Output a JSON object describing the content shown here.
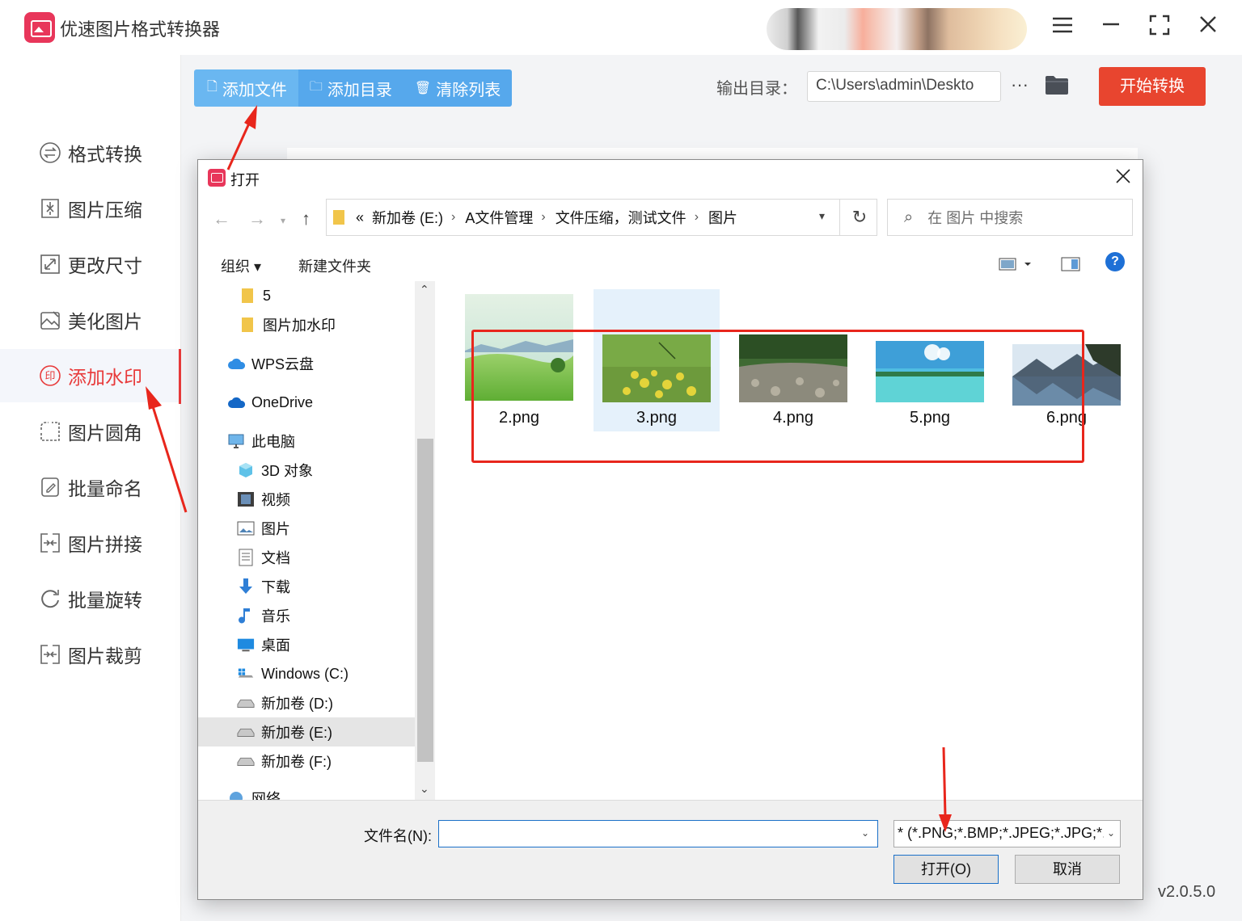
{
  "app": {
    "title": "优速图片格式转换器",
    "version": "v2.0.5.0"
  },
  "window_controls": [
    "menu-icon",
    "minimize-icon",
    "maximize-icon",
    "close-icon"
  ],
  "sidebar": {
    "items": [
      {
        "label": "格式转换",
        "icon": "format-convert-icon"
      },
      {
        "label": "图片压缩",
        "icon": "compress-icon"
      },
      {
        "label": "更改尺寸",
        "icon": "resize-icon"
      },
      {
        "label": "美化图片",
        "icon": "beautify-icon"
      },
      {
        "label": "添加水印",
        "icon": "watermark-icon",
        "active": true
      },
      {
        "label": "图片圆角",
        "icon": "round-corner-icon"
      },
      {
        "label": "批量命名",
        "icon": "rename-icon"
      },
      {
        "label": "图片拼接",
        "icon": "stitch-icon"
      },
      {
        "label": "批量旋转",
        "icon": "rotate-icon"
      },
      {
        "label": "图片裁剪",
        "icon": "crop-icon"
      }
    ]
  },
  "toolbar": {
    "add_file": "添加文件",
    "add_dir": "添加目录",
    "clear_list": "清除列表"
  },
  "output": {
    "label": "输出目录：",
    "path": "C:\\Users\\admin\\Deskto",
    "more": "···"
  },
  "start_button": "开始转换",
  "dialog": {
    "title": "打开",
    "breadcrumb": {
      "overflow": "«",
      "segments": [
        "新加卷 (E:)",
        "A文件管理",
        "文件压缩，测试文件",
        "图片"
      ]
    },
    "search_placeholder": "在 图片 中搜索",
    "commands": {
      "organize": "组织",
      "new_folder": "新建文件夹"
    },
    "tree": [
      {
        "label": "5",
        "icon": "folder-icon"
      },
      {
        "label": "图片加水印",
        "icon": "folder-icon"
      },
      {
        "label": "WPS云盘",
        "icon": "cloud-icon"
      },
      {
        "label": "OneDrive",
        "icon": "onedrive-icon"
      },
      {
        "label": "此电脑",
        "icon": "computer-icon"
      },
      {
        "label": "3D 对象",
        "icon": "3d-objects-icon"
      },
      {
        "label": "视频",
        "icon": "video-icon"
      },
      {
        "label": "图片",
        "icon": "pictures-icon"
      },
      {
        "label": "文档",
        "icon": "documents-icon"
      },
      {
        "label": "下载",
        "icon": "download-icon"
      },
      {
        "label": "音乐",
        "icon": "music-icon"
      },
      {
        "label": "桌面",
        "icon": "desktop-icon"
      },
      {
        "label": "Windows (C:)",
        "icon": "drive-windows-icon"
      },
      {
        "label": "新加卷 (D:)",
        "icon": "drive-icon"
      },
      {
        "label": "新加卷 (E:)",
        "icon": "drive-icon",
        "selected": true
      },
      {
        "label": "新加卷 (F:)",
        "icon": "drive-icon"
      },
      {
        "label": "网络",
        "icon": "network-icon"
      }
    ],
    "files": [
      {
        "name": "2.png",
        "thumb": "meadow-image"
      },
      {
        "name": "3.png",
        "thumb": "yellow-flowers-image",
        "selected": true
      },
      {
        "name": "4.png",
        "thumb": "river-stones-image"
      },
      {
        "name": "5.png",
        "thumb": "tropical-beach-image"
      },
      {
        "name": "6.png",
        "thumb": "mountain-lake-image"
      }
    ],
    "filename_label": "文件名(N):",
    "filename_value": "",
    "filter_value": "* (*.PNG;*.BMP;*.JPEG;*.JPG;*.I",
    "open_button": "打开(O)",
    "cancel_button": "取消"
  },
  "colors": {
    "accent_red": "#e8452f",
    "toolbar_blue": "#56a8ec",
    "active_side": "#e83a3a",
    "annotation_red": "#e8261c"
  }
}
